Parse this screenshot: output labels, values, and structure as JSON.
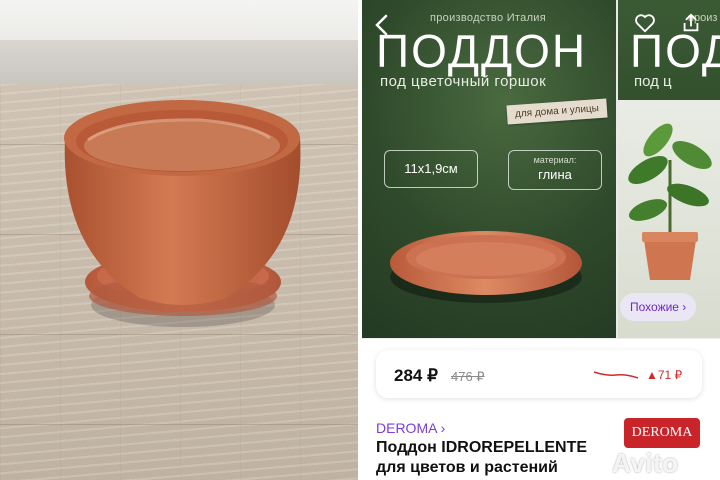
{
  "listing": {
    "origin": "производство Италия",
    "title": "ПОДДОН",
    "subtitle": "под цветочный горшок",
    "tag": "для дома и улицы",
    "size": "11х1,9см",
    "material_label": "материал:",
    "material_value": "глина",
    "side_title": "ПОД",
    "side_subtitle": "под ц",
    "side_origin": "произ",
    "similar_button": "Похожие ›",
    "price": "284 ₽",
    "old_price": "476 ₽",
    "price_delta": "▲71 ₽",
    "brand": "DEROMA ›",
    "product_title": "Поддон IDROREPELLENTE для цветов и растений",
    "brand_logo": "DEROMA",
    "watermark": "Avito"
  },
  "colors": {
    "terracotta": "#c96a45",
    "accent_purple": "#7b3ddc",
    "price_up_red": "#d02b2b",
    "banner_green": "#2f4a2b"
  },
  "icons": {
    "back": "chevron-left-icon",
    "favorite": "heart-icon",
    "share": "share-icon",
    "trend": "price-trend-icon"
  }
}
